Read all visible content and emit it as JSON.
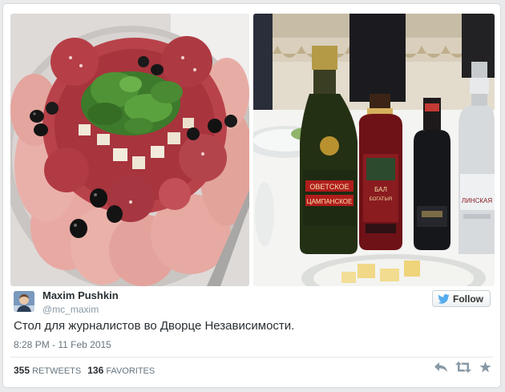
{
  "author": {
    "full_name": "Maxim Pushkin",
    "handle": "@mc_maxim"
  },
  "follow": {
    "label": "Follow",
    "icon": "twitter-bird-icon"
  },
  "tweet": {
    "text": "Стол для журналистов во Дворце Независимости.",
    "timestamp": "8:28 PM - 11 Feb 2015"
  },
  "stats": {
    "retweets_count": "355",
    "retweets_label": "RETWEETS",
    "favorites_count": "136",
    "favorites_label": "FAVORITES"
  },
  "actions": [
    "reply-icon",
    "retweet-icon",
    "favorite-icon"
  ],
  "photos": {
    "left": {
      "subject": "platter of cold cuts and olives with parsley"
    },
    "right": {
      "subject": "bottles of drinks on a banquet table",
      "labels": {
        "champagne_line1": "ОВЕТСКОЕ",
        "champagne_line2": "ЦАМПАНСКОЕ",
        "balsam_line1": "БАЛ",
        "balsam_line2": "БОГАТЫЯ",
        "vodka": "ЛИНСКАЯ"
      }
    }
  },
  "colors": {
    "twitter_blue": "#55acee",
    "text": "#292f33",
    "muted": "#8899a6"
  }
}
